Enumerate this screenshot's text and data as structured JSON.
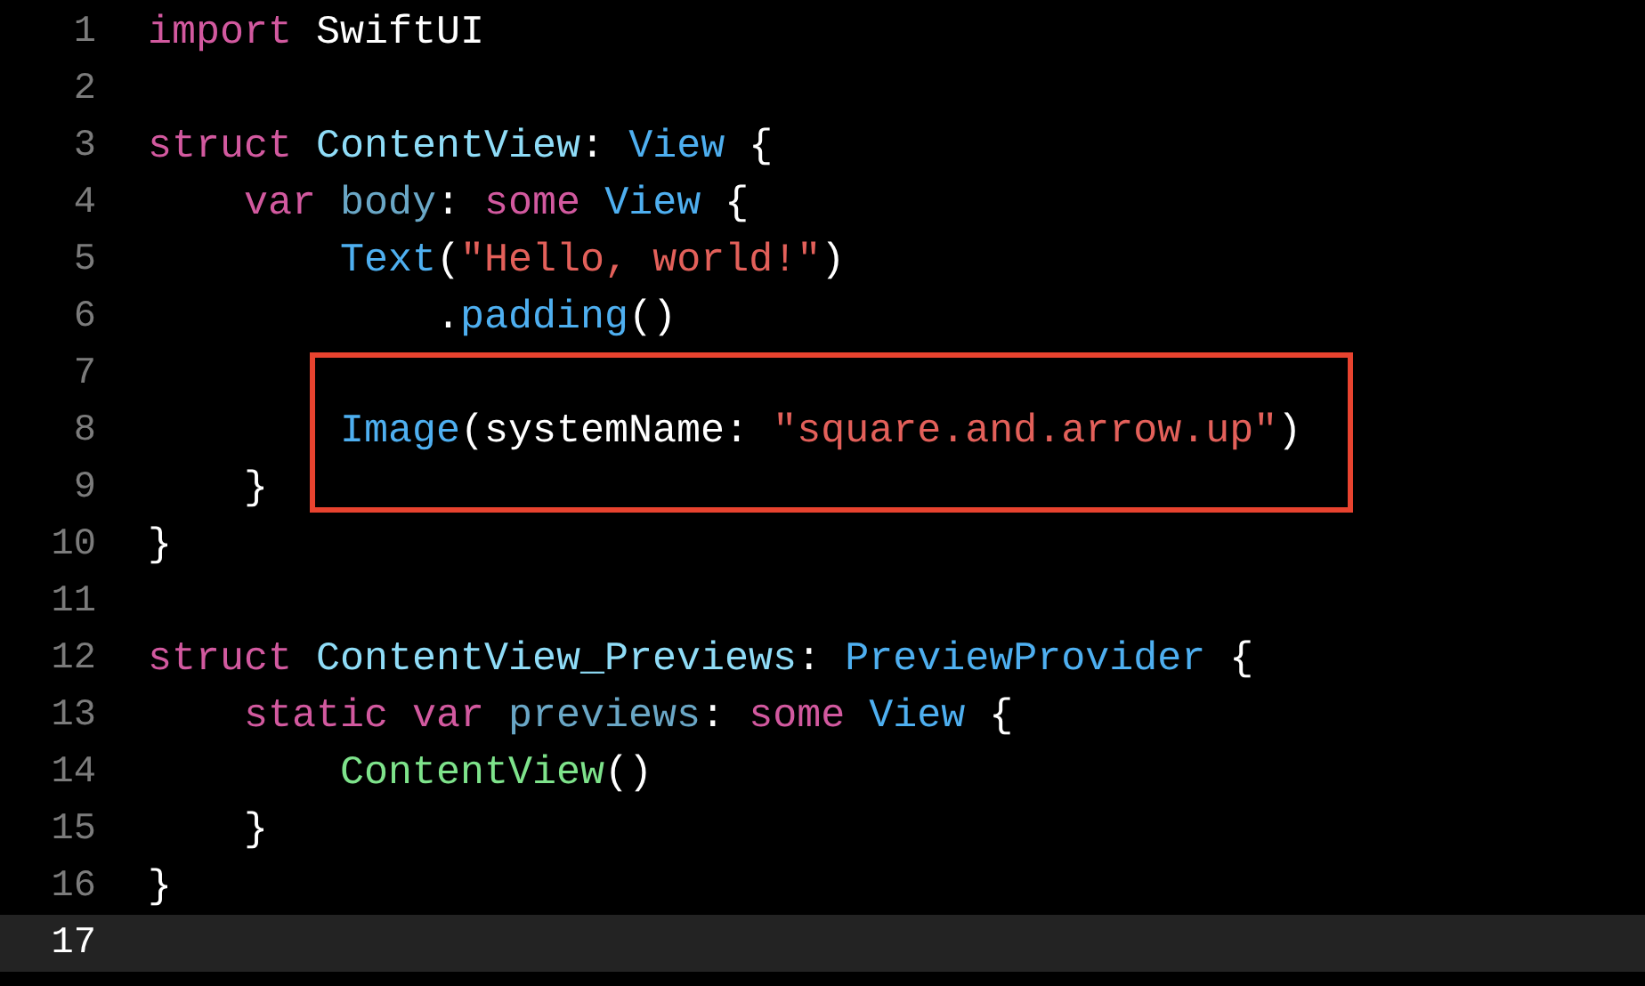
{
  "editor": {
    "lines": [
      {
        "number": "1",
        "current": false,
        "boxed": false,
        "tokens": [
          {
            "kind": "keyword",
            "text": "import"
          },
          {
            "kind": "plain",
            "text": " SwiftUI"
          }
        ]
      },
      {
        "number": "2",
        "current": false,
        "boxed": false
      },
      {
        "number": "3",
        "current": false,
        "boxed": false,
        "tokens": [
          {
            "kind": "keyword",
            "text": "struct"
          },
          {
            "kind": "decl",
            "text": " ContentView"
          },
          {
            "kind": "plain",
            "text": ":"
          },
          {
            "kind": "type",
            "text": " View"
          },
          {
            "kind": "plain",
            "text": " {"
          }
        ]
      },
      {
        "number": "4",
        "current": false,
        "boxed": false,
        "tokens": [
          {
            "kind": "keyword",
            "text": "    var"
          },
          {
            "kind": "property",
            "text": " body"
          },
          {
            "kind": "plain",
            "text": ":"
          },
          {
            "kind": "keyword",
            "text": " some"
          },
          {
            "kind": "type",
            "text": " View"
          },
          {
            "kind": "plain",
            "text": " {"
          }
        ]
      },
      {
        "number": "5",
        "current": false,
        "boxed": false,
        "tokens": [
          {
            "kind": "type",
            "text": "        Text"
          },
          {
            "kind": "plain",
            "text": "("
          },
          {
            "kind": "string",
            "text": "\"Hello, world!\""
          },
          {
            "kind": "plain",
            "text": ")"
          }
        ]
      },
      {
        "number": "6",
        "current": false,
        "boxed": false,
        "tokens": [
          {
            "kind": "plain",
            "text": "            ."
          },
          {
            "kind": "type",
            "text": "padding"
          },
          {
            "kind": "plain",
            "text": "()"
          }
        ]
      },
      {
        "number": "7",
        "current": false,
        "boxed": true
      },
      {
        "number": "8",
        "current": false,
        "boxed": true,
        "tokens": [
          {
            "kind": "type",
            "text": "        Image"
          },
          {
            "kind": "plain",
            "text": "(systemName:"
          },
          {
            "kind": "string",
            "text": " \"square.and.arrow.up\""
          },
          {
            "kind": "plain",
            "text": ")"
          }
        ]
      },
      {
        "number": "9",
        "current": false,
        "boxed": true,
        "tokens": [
          {
            "kind": "plain",
            "text": "    }"
          }
        ]
      },
      {
        "number": "10",
        "current": false,
        "boxed": false,
        "tokens": [
          {
            "kind": "plain",
            "text": "}"
          }
        ]
      },
      {
        "number": "11",
        "current": false,
        "boxed": false
      },
      {
        "number": "12",
        "current": false,
        "boxed": false,
        "tokens": [
          {
            "kind": "keyword",
            "text": "struct"
          },
          {
            "kind": "decl",
            "text": " ContentView_Previews"
          },
          {
            "kind": "plain",
            "text": ":"
          },
          {
            "kind": "type",
            "text": " PreviewProvider"
          },
          {
            "kind": "plain",
            "text": " {"
          }
        ]
      },
      {
        "number": "13",
        "current": false,
        "boxed": false,
        "tokens": [
          {
            "kind": "keyword",
            "text": "    static var"
          },
          {
            "kind": "property",
            "text": " previews"
          },
          {
            "kind": "plain",
            "text": ":"
          },
          {
            "kind": "keyword",
            "text": " some"
          },
          {
            "kind": "type",
            "text": " View"
          },
          {
            "kind": "plain",
            "text": " {"
          }
        ]
      },
      {
        "number": "14",
        "current": false,
        "boxed": false,
        "tokens": [
          {
            "kind": "call",
            "text": "        ContentView"
          },
          {
            "kind": "plain",
            "text": "()"
          }
        ]
      },
      {
        "number": "15",
        "current": false,
        "boxed": false,
        "tokens": [
          {
            "kind": "plain",
            "text": "    }"
          }
        ]
      },
      {
        "number": "16",
        "current": false,
        "boxed": false,
        "tokens": [
          {
            "kind": "plain",
            "text": "}"
          }
        ]
      },
      {
        "number": "17",
        "current": true,
        "boxed": false
      }
    ]
  }
}
